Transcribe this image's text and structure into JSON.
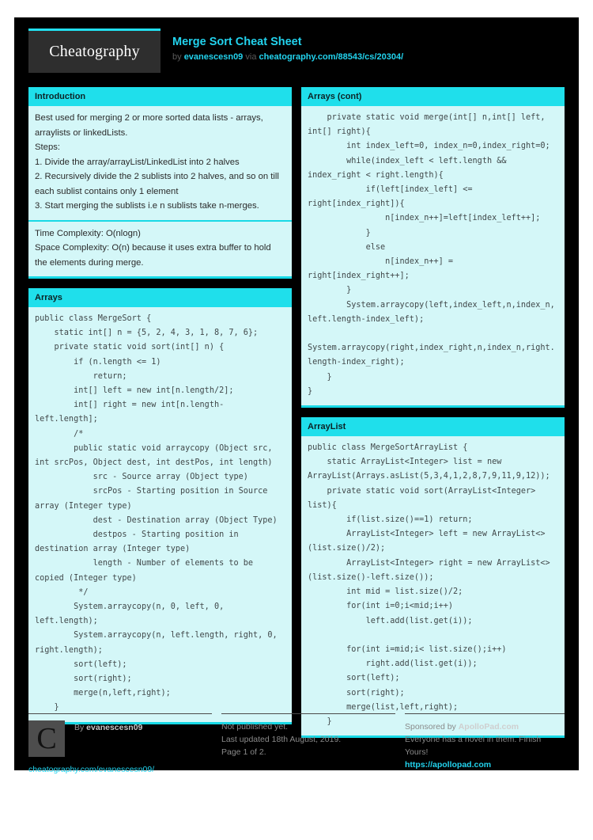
{
  "header": {
    "logo_text": "Cheatography",
    "title": "Merge Sort Cheat Sheet",
    "by_label": "by ",
    "author": "evanescesn09",
    "via_label": " via ",
    "source_url": "cheatography.com/88543/cs/20304/"
  },
  "left_column": {
    "introduction": {
      "header": "Introduction",
      "body": "Best used for merging 2 or more sorted data lists - arrays, arraylists or linkedLists.\nSteps:\n1. Divide the array/arrayList/LinkedList into 2 halves\n2. Recursively divide the 2 sublists into 2 halves, and so on till each sublist contains only 1 element\n3. Start merging the sublists i.e n sublists take n-merges.",
      "complexity": "Time Complexity: O(nlogn)\nSpace Complexity: O(n) because it uses extra buffer to hold the elements during merge."
    },
    "arrays": {
      "header": "Arrays",
      "code": "public class MergeSort {\n    static int[] n = {5, 2, 4, 3, 1, 8, 7, 6};\n    private static void sort(int[] n) {\n        if (n.length <= 1)\n            return;\n        int[] left = new int[n.length/2];\n        int[] right = new int[n.length-left.length];\n        /*\n        public static void arraycopy (Object src, int srcPos, Object dest, int destPos, int length)\n            src - Source array (Object type)\n            srcPos - Starting position in Source array (Integer type)\n            dest - Destination array (Object Type)\n            destpos - Starting position in destination array (Integer type)\n            length - Number of elements to be copied (Integer type)\n         */\n        System.arraycopy(n, 0, left, 0, left.length);\n        System.arraycopy(n, left.length, right, 0, right.length);\n        sort(left);\n        sort(right);\n        merge(n,left,right);\n    }"
    }
  },
  "right_column": {
    "arrays_cont": {
      "header": "Arrays (cont)",
      "code": "    private static void merge(int[] n,int[] left, int[] right){\n        int index_left=0, index_n=0,index_right=0;\n        while(index_left < left.length && index_right < right.length){\n            if(left[index_left] <= right[index_right]){\n                n[index_n++]=left[index_left++];\n            }\n            else\n                n[index_n++] = right[index_right++];\n        }\n        System.arraycopy(left,index_left,n,index_n, left.length-index_left);\n        System.arraycopy(right,index_right,n,index_n,right.length-index_right);\n    }\n}"
    },
    "arraylist": {
      "header": "ArrayList",
      "code": "public class MergeSortArrayList {\n    static ArrayList<Integer> list = new ArrayList(Arrays.asList(5,3,4,1,2,8,7,9,11,9,12));\n    private static void sort(ArrayList<Integer> list){\n        if(list.size()==1) return;\n        ArrayList<Integer> left = new ArrayList<>(list.size()/2);\n        ArrayList<Integer> right = new ArrayList<>(list.size()-left.size());\n        int mid = list.size()/2;\n        for(int i=0;i<mid;i++)\n            left.add(list.get(i));\n\n        for(int i=mid;i< list.size();i++)\n            right.add(list.get(i));\n        sort(left);\n        sort(right);\n        merge(list,left,right);\n    }"
    }
  },
  "footer": {
    "by_label": "By ",
    "author": "evanescesn09",
    "profile_url": "cheatography.com/evanescesn09/",
    "publish_status": "Not published yet.",
    "last_updated": "Last updated 18th August, 2019.",
    "page_number": "Page 1 of 2.",
    "sponsor_prefix": "Sponsored by ",
    "sponsor_name": "ApolloPad.com",
    "sponsor_tagline": "Everyone has a novel in them. Finish Yours!",
    "sponsor_url": "https://apollopad.com"
  },
  "colors": {
    "accent": "#22d3ee",
    "card_header": "#1fdfeb",
    "card_body": "#d4f7f8",
    "page_background": "#000000"
  }
}
